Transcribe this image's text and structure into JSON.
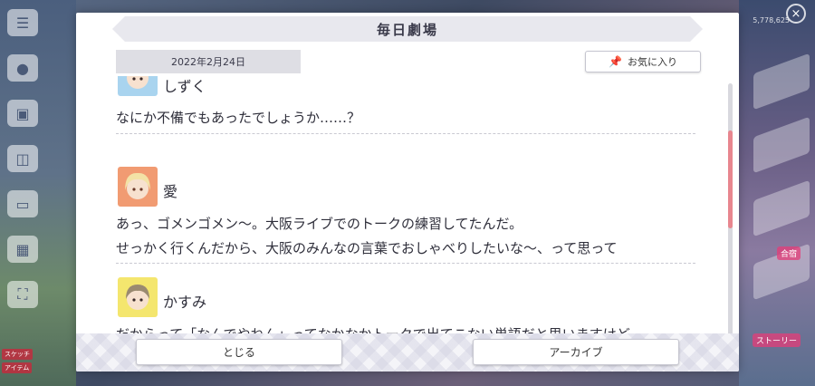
{
  "background": {
    "left_labels": [
      "スケッチ",
      "アイテム"
    ],
    "right_labels": [
      "合宿",
      "ストーリー"
    ],
    "currency_top": "5,778,625",
    "close_icon": "close-icon"
  },
  "modal": {
    "title": "毎日劇場",
    "date": "2022年2月24日",
    "favorite_label": "お気に入り",
    "entries": [
      {
        "speaker": "しずく",
        "avatar_color": "#a9d4ef",
        "lines": [
          "なにか不備でもあったでしょうか……？"
        ]
      },
      {
        "speaker": "愛",
        "avatar_color": "#f19b72",
        "lines": [
          "あっ、ゴメンゴメン～。大阪ライブでのトークの練習してたんだ。",
          "せっかく行くんだから、大阪のみんなの言葉でおしゃべりしたいな～、って思って"
        ]
      },
      {
        "speaker": "かすみ",
        "avatar_color": "#f4e66e",
        "lines": [
          "だからって「なんでやねん」ってなかなかトークで出てこない単語だと思いますけど……"
        ]
      }
    ],
    "close_label": "とじる",
    "archive_label": "アーカイブ"
  },
  "colors": {
    "scroll_thumb": "#e8868f",
    "title_bar": "#e8e8ee",
    "date_badge": "#dedee4"
  }
}
